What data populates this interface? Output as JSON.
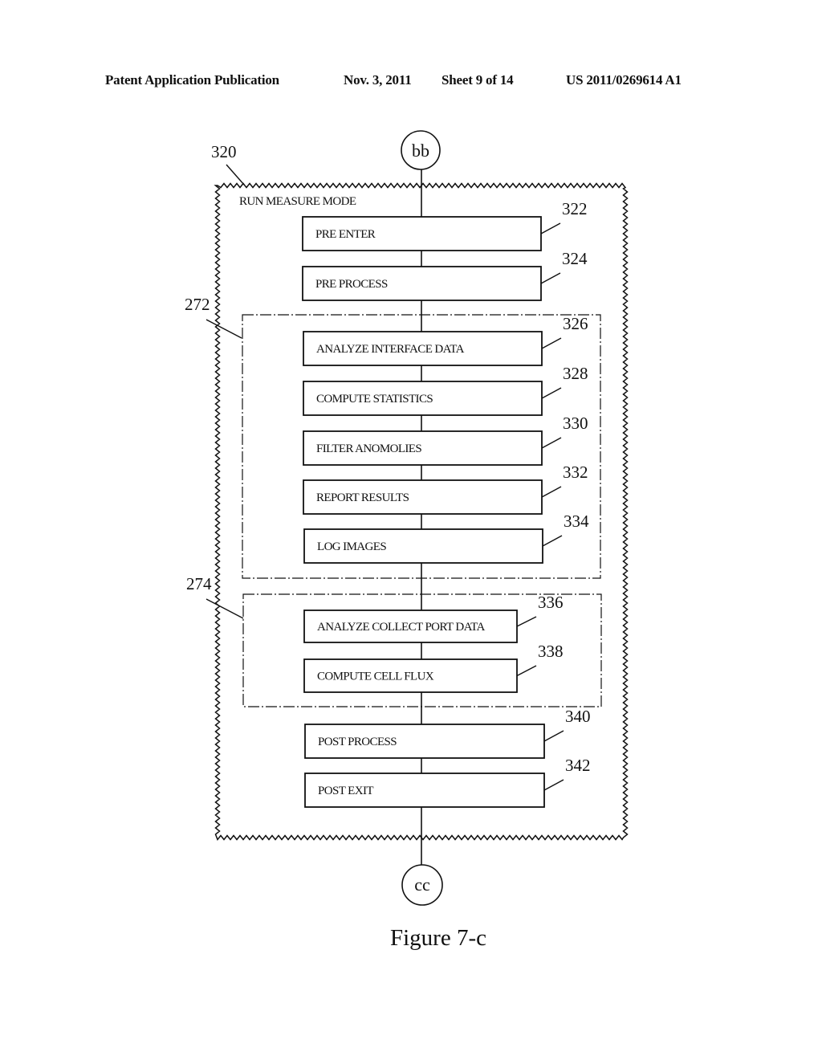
{
  "header": {
    "publication": "Patent Application Publication",
    "date": "Nov. 3, 2011",
    "sheet": "Sheet 9 of 14",
    "number": "US 2011/0269614 A1"
  },
  "diagram": {
    "outer_ref": "320",
    "outer_title": "RUN MEASURE MODE",
    "connector_top": "bb",
    "connector_bottom": "cc",
    "group_a_ref": "272",
    "group_b_ref": "274",
    "steps": [
      {
        "label": "PRE ENTER",
        "ref": "322"
      },
      {
        "label": "PRE PROCESS",
        "ref": "324"
      },
      {
        "label": "ANALYZE INTERFACE DATA",
        "ref": "326"
      },
      {
        "label": "COMPUTE STATISTICS",
        "ref": "328"
      },
      {
        "label": "FILTER ANOMOLIES",
        "ref": "330"
      },
      {
        "label": "REPORT RESULTS",
        "ref": "332"
      },
      {
        "label": "LOG IMAGES",
        "ref": "334"
      },
      {
        "label": "ANALYZE COLLECT PORT DATA",
        "ref": "336"
      },
      {
        "label": "COMPUTE CELL  FLUX",
        "ref": "338"
      },
      {
        "label": "POST PROCESS",
        "ref": "340"
      },
      {
        "label": "POST EXIT",
        "ref": "342"
      }
    ],
    "caption": "Figure 7-c"
  }
}
